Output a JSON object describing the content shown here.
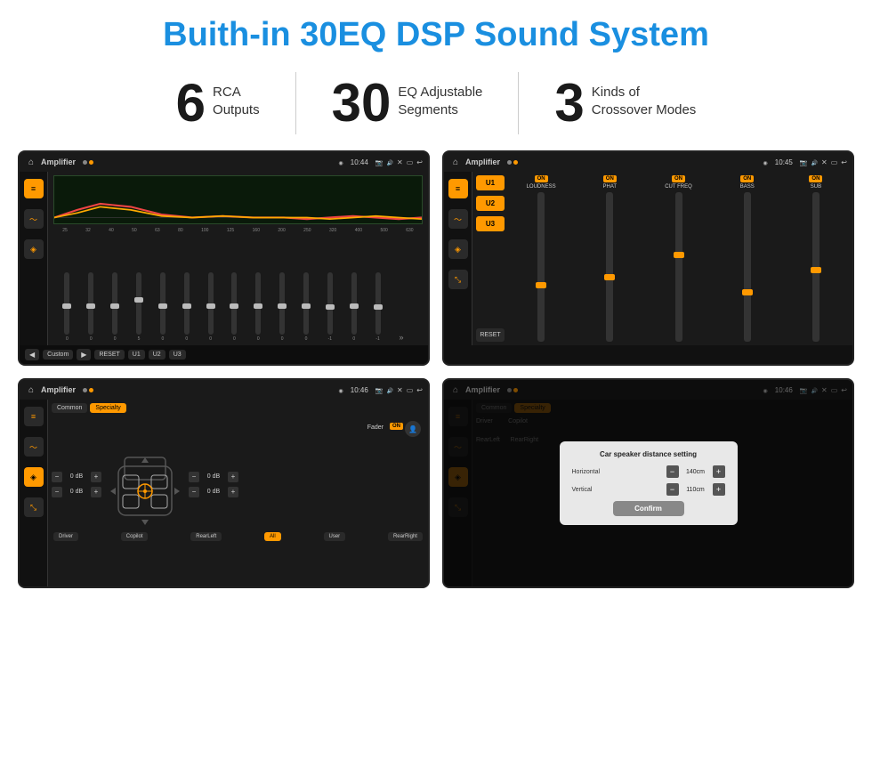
{
  "title": "Buith-in 30EQ DSP Sound System",
  "stats": [
    {
      "number": "6",
      "text": "RCA\nOutputs"
    },
    {
      "number": "30",
      "text": "EQ Adjustable\nSegments"
    },
    {
      "number": "3",
      "text": "Kinds of\nCrossover Modes"
    }
  ],
  "screens": [
    {
      "id": "eq-screen",
      "topbar": {
        "title": "Amplifier",
        "time": "10:44"
      },
      "type": "eq",
      "freqs": [
        "25",
        "32",
        "40",
        "50",
        "63",
        "80",
        "100",
        "125",
        "160",
        "200",
        "250",
        "320",
        "400",
        "500",
        "630"
      ],
      "values": [
        "0",
        "0",
        "0",
        "5",
        "0",
        "0",
        "0",
        "0",
        "0",
        "0",
        "0",
        "-1",
        "0",
        "-1"
      ],
      "preset": "Custom",
      "buttons": [
        "RESET",
        "U1",
        "U2",
        "U3"
      ]
    },
    {
      "id": "amp-screen",
      "topbar": {
        "title": "Amplifier",
        "time": "10:45"
      },
      "type": "amplifier",
      "presets": [
        "U1",
        "U2",
        "U3"
      ],
      "controls": [
        {
          "label": "LOUDNESS",
          "on": true
        },
        {
          "label": "PHAT",
          "on": true
        },
        {
          "label": "CUT FREQ",
          "on": true
        },
        {
          "label": "BASS",
          "on": true
        },
        {
          "label": "SUB",
          "on": true
        }
      ]
    },
    {
      "id": "fader-screen",
      "topbar": {
        "title": "Amplifier",
        "time": "10:46"
      },
      "type": "fader",
      "tabs": [
        "Common",
        "Specialty"
      ],
      "activeTab": "Specialty",
      "faderLabel": "Fader",
      "faderOn": true,
      "dbValues": [
        "0 dB",
        "0 dB",
        "0 dB",
        "0 dB"
      ],
      "buttons": [
        "Driver",
        "Copilot",
        "RearLeft",
        "All",
        "User",
        "RearRight"
      ]
    },
    {
      "id": "dialog-screen",
      "topbar": {
        "title": "Amplifier",
        "time": "10:46"
      },
      "type": "dialog",
      "tabs": [
        "Common",
        "Specialty"
      ],
      "dialog": {
        "title": "Car speaker distance setting",
        "horizontal": {
          "label": "Horizontal",
          "value": "140cm"
        },
        "vertical": {
          "label": "Vertical",
          "value": "110cm"
        },
        "confirm": "Confirm"
      }
    }
  ],
  "colors": {
    "accent": "#1a8fe0",
    "orange": "#f90",
    "bg_dark": "#1a1a1a",
    "text_light": "#cccccc"
  }
}
